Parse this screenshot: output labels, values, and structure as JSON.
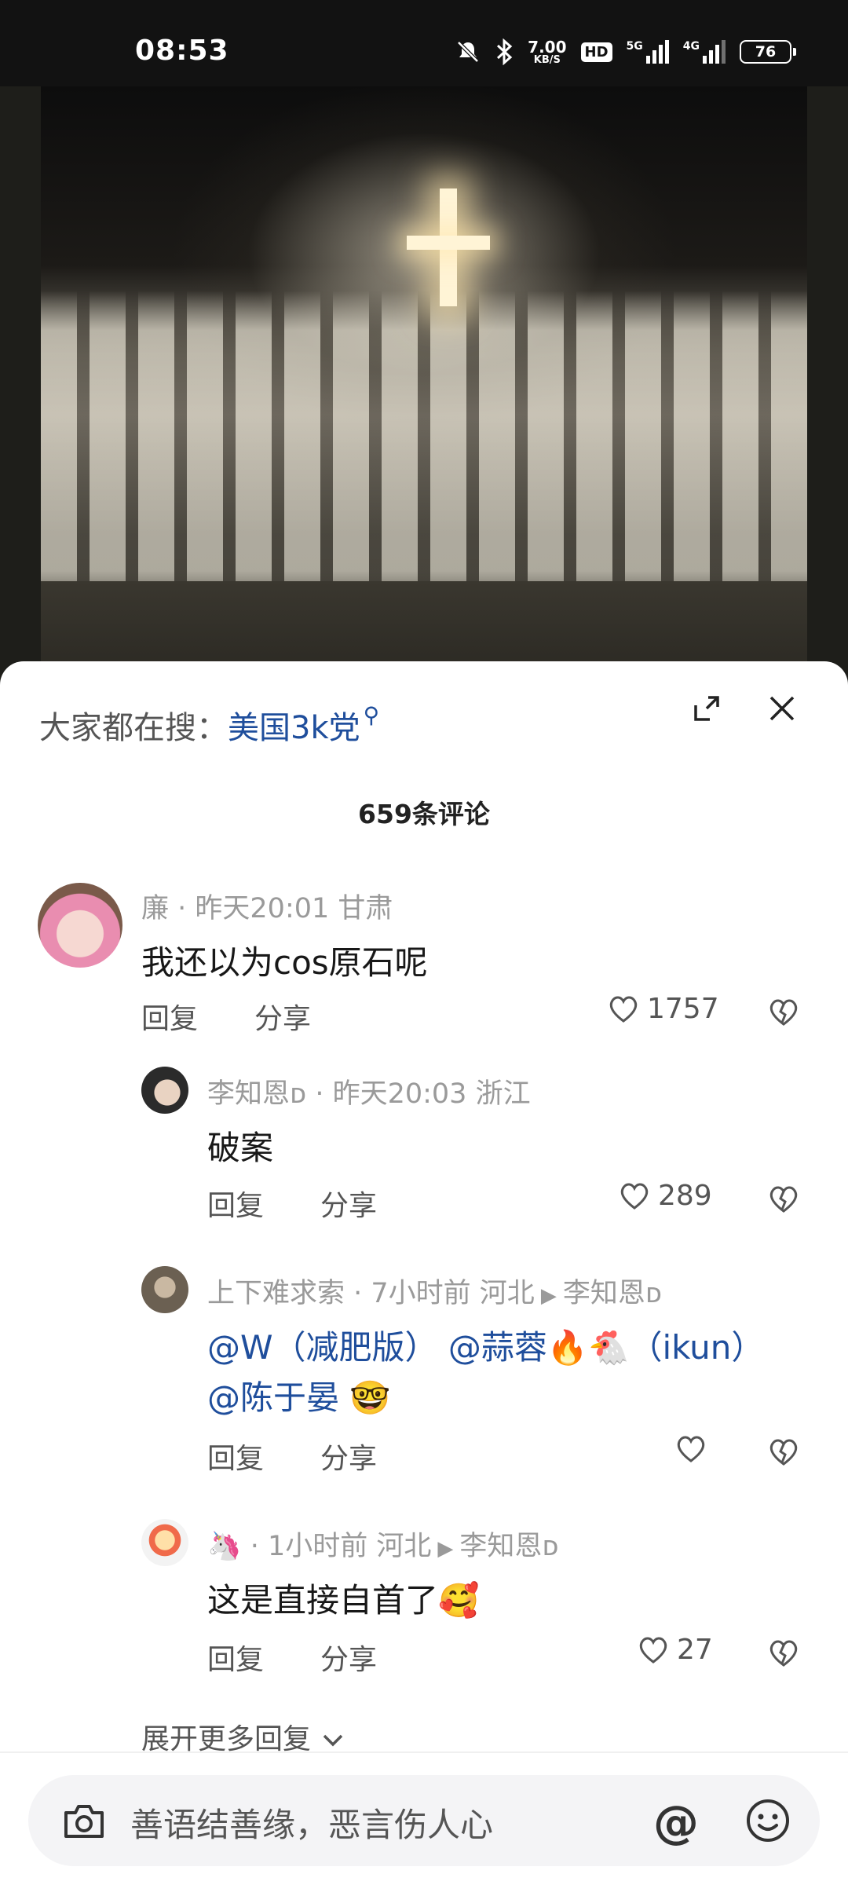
{
  "status_bar": {
    "time": "08:53",
    "net_speed_value": "7.00",
    "net_speed_unit": "KB/S",
    "hd_badge": "HD",
    "net1": "5G",
    "net2": "4G",
    "battery": "76"
  },
  "sheet": {
    "search_label": "大家都在搜：",
    "search_term": "美国3k党",
    "comment_count": "659条评论"
  },
  "comments": [
    {
      "author": "廉",
      "time_location": "昨天20:01 甘肃",
      "text": "我还以为cos原石呢",
      "reply": "回复",
      "share": "分享",
      "likes": "1757"
    },
    {
      "author": "李知恩ᴅ",
      "time_location": "昨天20:03 浙江",
      "text": "破案",
      "reply": "回复",
      "share": "分享",
      "likes": "289"
    },
    {
      "author": "上下难求索",
      "time_location": "7小时前 河北",
      "reply_to": "李知恩ᴅ",
      "text_line1": "@W（减肥版） @蒜蓉🔥🐔（ikun）",
      "text_line2": "@陈于晏 🤓",
      "reply": "回复",
      "share": "分享",
      "likes": ""
    },
    {
      "author": "🦄",
      "time_location": "1小时前 河北",
      "reply_to": "李知恩ᴅ",
      "text": "这是直接自首了🥰",
      "reply": "回复",
      "share": "分享",
      "likes": "27"
    }
  ],
  "more_replies": "展开更多回复",
  "input": {
    "placeholder": "善语结善缘，恶言伤人心",
    "at_symbol": "@"
  },
  "colors": {
    "mention": "#1f4e9c",
    "meta_gray": "#9a9a9a"
  }
}
